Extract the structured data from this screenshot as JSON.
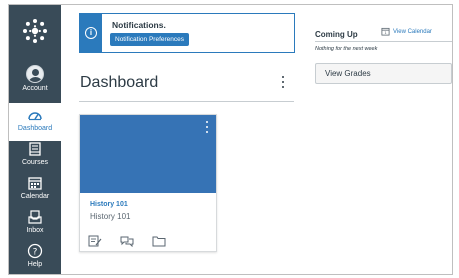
{
  "global_nav": {
    "items": [
      {
        "label": "Account",
        "icon": "avatar"
      },
      {
        "label": "Dashboard",
        "icon": "dashboard-icon",
        "active": true
      },
      {
        "label": "Courses",
        "icon": "courses-icon"
      },
      {
        "label": "Calendar",
        "icon": "calendar-icon"
      },
      {
        "label": "Inbox",
        "icon": "inbox-icon"
      },
      {
        "label": "Help",
        "icon": "help-icon"
      }
    ]
  },
  "notification": {
    "title": "Notifications.",
    "button_label": "Notification Preferences"
  },
  "header": {
    "title": "Dashboard"
  },
  "course_card": {
    "name": "History 101",
    "code": "History 101",
    "hero_color": "#3673b5",
    "icons": [
      "assignments-icon",
      "discussions-icon",
      "files-icon"
    ]
  },
  "sidebar": {
    "coming_up_title": "Coming Up",
    "view_calendar_label": "View Calendar",
    "empty_text": "Nothing for the next week",
    "view_grades_label": "View Grades"
  },
  "colors": {
    "nav_bg": "#394b58",
    "accent": "#2b7abc"
  }
}
